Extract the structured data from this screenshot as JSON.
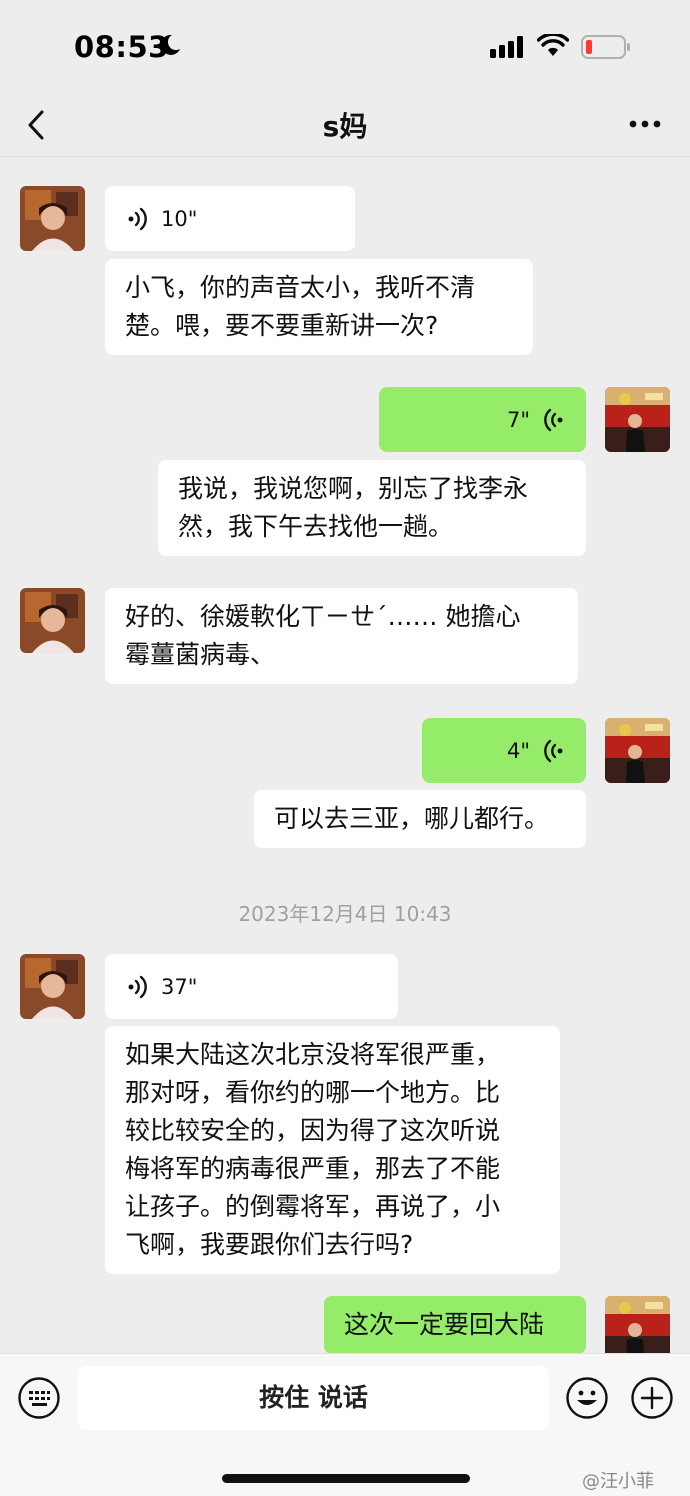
{
  "status_bar": {
    "time": "08:53"
  },
  "nav": {
    "title": "s妈"
  },
  "messages": [
    {
      "side": "in",
      "type": "voice",
      "duration": "10\""
    },
    {
      "side": "in",
      "type": "text",
      "text": "小飞，你的声音太小，我听不清\n楚。喂，要不要重新讲一次?"
    },
    {
      "side": "out",
      "type": "voice",
      "duration": "7\""
    },
    {
      "side": "out",
      "type": "text",
      "text": "我说，我说您啊，别忘了找李永\n然，我下午去找他一趟。"
    },
    {
      "side": "in",
      "type": "text",
      "text": "好的、徐媛軟化ㄒㄧㄝˊ…… 她擔心\n霉薑菌病毒、"
    },
    {
      "side": "out",
      "type": "voice",
      "duration": "4\""
    },
    {
      "side": "out",
      "type": "text",
      "text": "可以去三亚，哪儿都行。"
    },
    {
      "type": "timestamp",
      "text": "2023年12月4日 10:43"
    },
    {
      "side": "in",
      "type": "voice",
      "duration": "37\""
    },
    {
      "side": "in",
      "type": "text",
      "text": "如果大陆这次北京没将军很严重，\n那对呀，看你约的哪一个地方。比\n较比较安全的，因为得了这次听说\n梅将军的病毒很严重，那去了不能\n让孩子。的倒霉将军，再说了，小\n飞啊，我要跟你们去行吗?"
    },
    {
      "side": "out",
      "type": "text",
      "text": "这次一定要回大陆"
    }
  ],
  "input_bar": {
    "hold_to_talk": "按住 说话"
  },
  "watermark": "@汪小菲",
  "colors": {
    "background": "#ededed",
    "outgoing_bubble": "#95ec69",
    "incoming_bubble": "#ffffff"
  }
}
